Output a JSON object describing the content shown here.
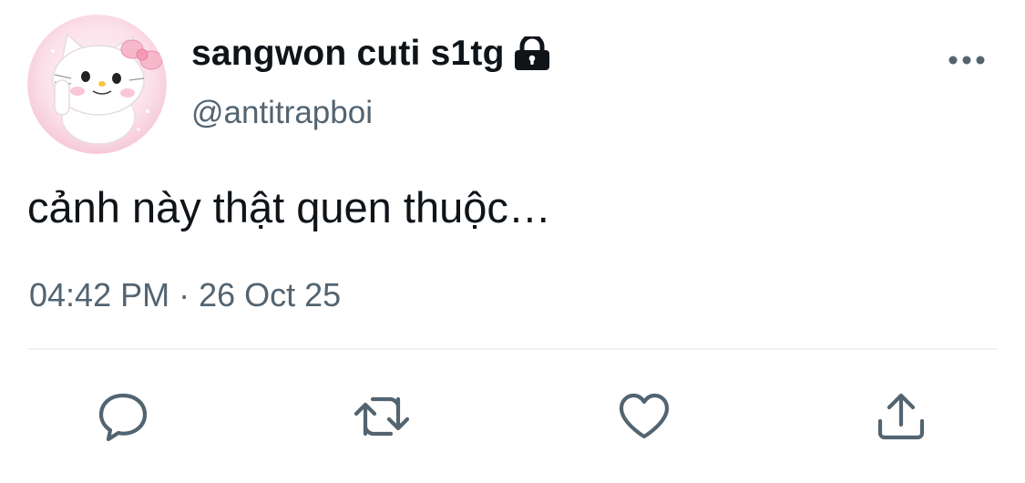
{
  "tweet": {
    "display_name": "sangwon cuti s1tg",
    "handle": "@antitrapboi",
    "text": "cảnh này thật quen thuộc…",
    "timestamp": "04:42 PM · 26 Oct 25",
    "protected": true
  },
  "icons": {
    "avatar": "white-kitty-with-pink-bow",
    "lock": "lock-icon",
    "more": "more-horizontal-icon",
    "reply": "reply-icon",
    "retweet": "retweet-icon",
    "like": "heart-icon",
    "share": "share-icon"
  },
  "colors": {
    "text_primary": "#0f1419",
    "text_secondary": "#536471",
    "divider": "#eff3f4",
    "avatar_bg": "#f7d2df"
  }
}
